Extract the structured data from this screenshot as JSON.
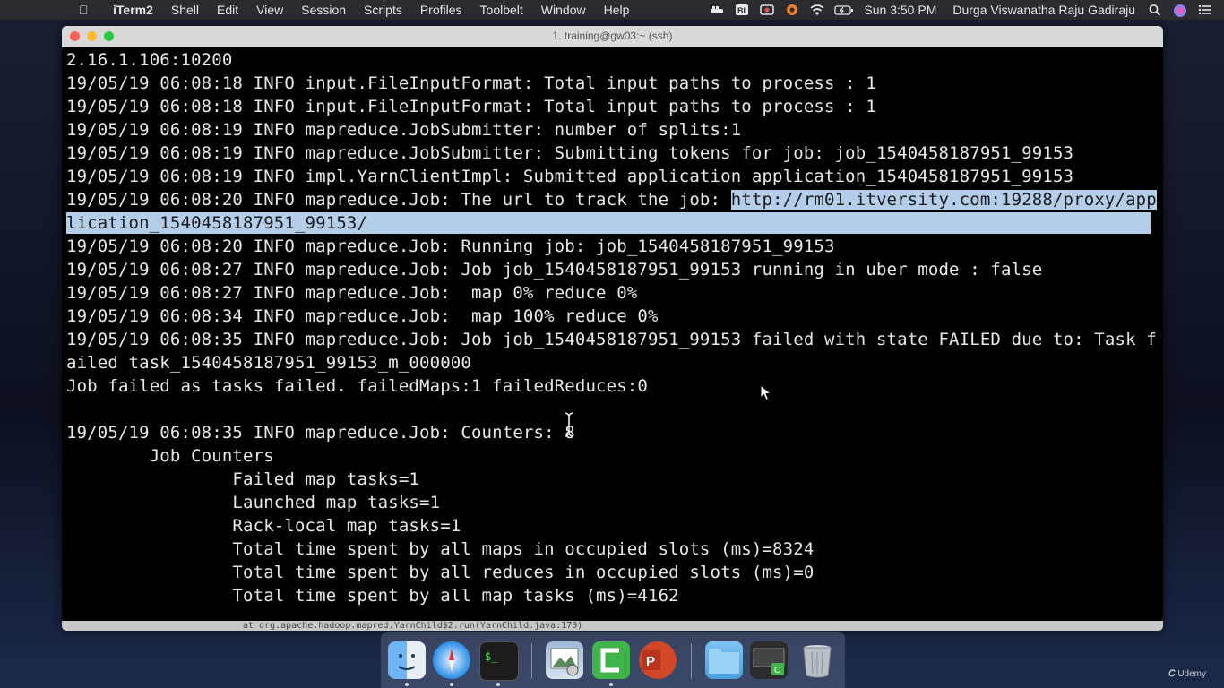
{
  "menubar": {
    "app_name": "iTerm2",
    "items": [
      "Shell",
      "Edit",
      "View",
      "Session",
      "Scripts",
      "Profiles",
      "Toolbelt",
      "Window",
      "Help"
    ],
    "clock": "Sun 3:50 PM",
    "user": "Durga Viswanatha Raju Gadiraju"
  },
  "window": {
    "title": "1. training@gw03:~ (ssh)"
  },
  "terminal": {
    "lines": [
      "2.16.1.106:10200",
      "19/05/19 06:08:18 INFO input.FileInputFormat: Total input paths to process : 1",
      "19/05/19 06:08:18 INFO input.FileInputFormat: Total input paths to process : 1",
      "19/05/19 06:08:19 INFO mapreduce.JobSubmitter: number of splits:1",
      "19/05/19 06:08:19 INFO mapreduce.JobSubmitter: Submitting tokens for job: job_1540458187951_99153",
      "19/05/19 06:08:19 INFO impl.YarnClientImpl: Submitted application application_1540458187951_99153",
      "19/05/19 06:08:20 INFO mapreduce.Job: The url to track the job: ",
      "http://rm01.itversity.com:19288/proxy/app",
      "lication_1540458187951_99153/",
      "19/05/19 06:08:20 INFO mapreduce.Job: Running job: job_1540458187951_99153",
      "19/05/19 06:08:27 INFO mapreduce.Job: Job job_1540458187951_99153 running in uber mode : false",
      "19/05/19 06:08:27 INFO mapreduce.Job:  map 0% reduce 0%",
      "19/05/19 06:08:34 INFO mapreduce.Job:  map 100% reduce 0%",
      "19/05/19 06:08:35 INFO mapreduce.Job: Job job_1540458187951_99153 failed with state FAILED due to: Task f",
      "ailed task_1540458187951_99153_m_000000",
      "Job failed as tasks failed. failedMaps:1 failedReduces:0",
      "19/05/19 06:08:35 INFO mapreduce.Job: Counters: 8",
      "        Job Counters",
      "                Failed map tasks=1",
      "                Launched map tasks=1",
      "                Rack-local map tasks=1",
      "                Total time spent by all maps in occupied slots (ms)=8324",
      "                Total time spent by all reduces in occupied slots (ms)=0",
      "                Total time spent by all map tasks (ms)=4162"
    ],
    "status_line": "at org.apache.hadoop.mapred.YarnChild$2.run(YarnChild.java:170)"
  },
  "dock": {
    "icons": [
      "finder-icon",
      "safari-icon",
      "terminal-icon",
      "preview-icon",
      "camtasia-icon",
      "powerpoint-icon",
      "folder-icon",
      "screen-recorder-icon",
      "trash-icon"
    ]
  },
  "watermark": "Udemy",
  "colors": {
    "selection": "#b4cde9",
    "terminal_bg": "#000000",
    "terminal_fg": "#e8e8e8"
  }
}
